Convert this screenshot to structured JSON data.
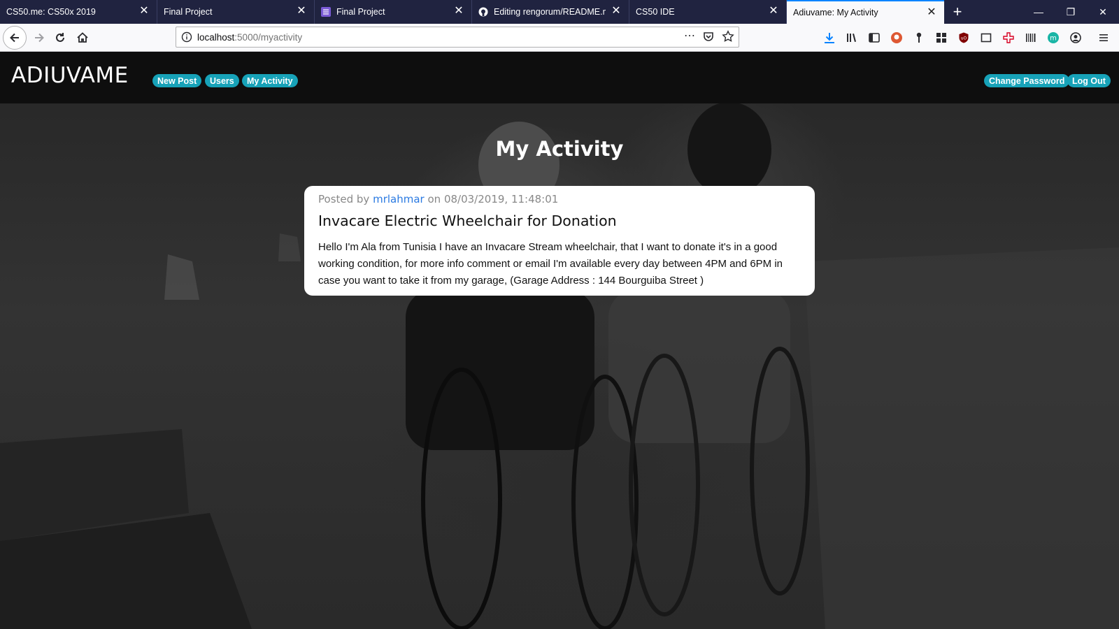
{
  "browser": {
    "tabs": [
      {
        "title": "CS50.me: CS50x 2019",
        "favicon": "none"
      },
      {
        "title": "Final Project",
        "favicon": "none"
      },
      {
        "title": "Final Project",
        "favicon": "form-icon"
      },
      {
        "title": "Editing rengorum/README.md",
        "favicon": "github-icon"
      },
      {
        "title": "CS50 IDE",
        "favicon": "none"
      },
      {
        "title": "Adiuvame: My Activity",
        "favicon": "none",
        "active": true
      }
    ],
    "url_host": "localhost",
    "url_path": ":5000/myactivity",
    "accent": "#0a84ff",
    "tabstrip_color": "#202340"
  },
  "site": {
    "brand": "ADIUVAME",
    "nav": {
      "new_post": "New Post",
      "users": "Users",
      "my_activity": "My Activity",
      "change_password": "Change Password",
      "log_out": "Log Out"
    },
    "pill_color": "#17a2b8"
  },
  "main": {
    "heading": "My Activity",
    "post": {
      "posted_by_prefix": "Posted by",
      "author": "mrlahmar",
      "posted_on": "on 08/03/2019, 11:48:01",
      "title": "Invacare Electric Wheelchair for Donation",
      "body": "Hello I'm Ala from Tunisia I have an Invacare Stream wheelchair, that I want to donate it's in a good working condition, for more info comment or email I'm available every day between 4PM and 6PM in case you want to take it from my garage, (Garage Address : 144 Bourguiba Street )"
    }
  }
}
